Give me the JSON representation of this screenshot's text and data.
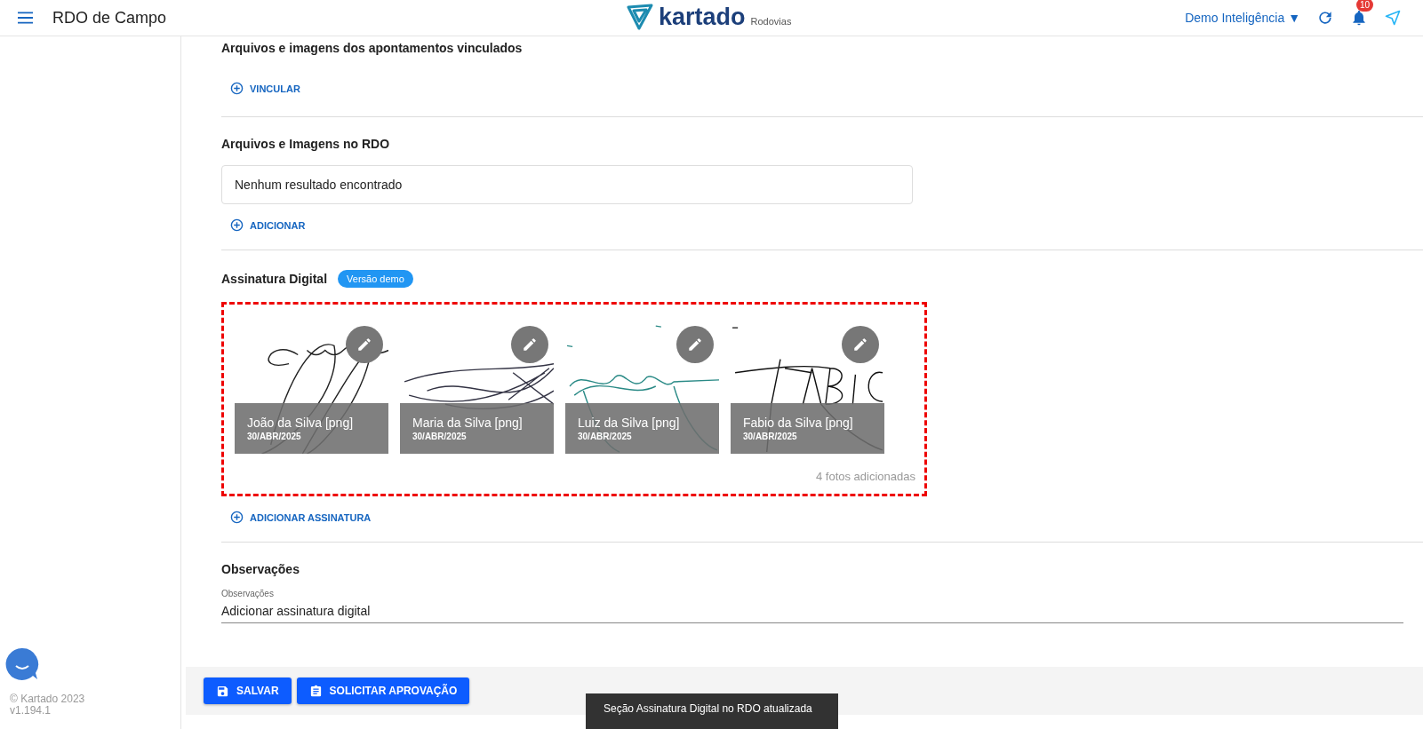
{
  "header": {
    "title": "RDO de Campo",
    "logo": "kartado",
    "logo_suffix": "Rodovias",
    "account": "Demo Inteligência",
    "account_caret": "▼",
    "notifications": "10"
  },
  "sections": [
    {
      "kind": "links",
      "title": "Arquivos e imagens dos apontamentos vinculados",
      "action": "VINCULAR"
    },
    {
      "kind": "files",
      "title": "Arquivos e Imagens no RDO",
      "empty": "Nenhum resultado encontrado",
      "action": "ADICIONAR"
    },
    {
      "kind": "signatures",
      "title": "Assinatura Digital",
      "badge": "Versão demo",
      "cards": [
        {
          "name": "João da Silva [png]",
          "date": "30/ABR/2025"
        },
        {
          "name": "Maria da Silva [png]",
          "date": "30/ABR/2025"
        },
        {
          "name": "Luiz da Silva [png]",
          "date": "30/ABR/2025"
        },
        {
          "name": "Fabio da Silva [png]",
          "date": "30/ABR/2025"
        }
      ],
      "count": "4 fotos adicionadas",
      "action": "ADICIONAR ASSINATURA"
    },
    {
      "kind": "notes",
      "title": "Observações",
      "field": {
        "label": "Observações",
        "value": "Adicionar assinatura digital"
      }
    }
  ],
  "footer": {
    "buttons": [
      {
        "kind": "save",
        "label": "SALVAR"
      },
      {
        "kind": "request",
        "label": "SOLICITAR APROVAÇÃO"
      }
    ]
  },
  "sidebar": {
    "copyright": "© Kartado 2023",
    "version": "v1.194.1"
  },
  "snackbar": "Seção Assinatura Digital no RDO atualizada"
}
